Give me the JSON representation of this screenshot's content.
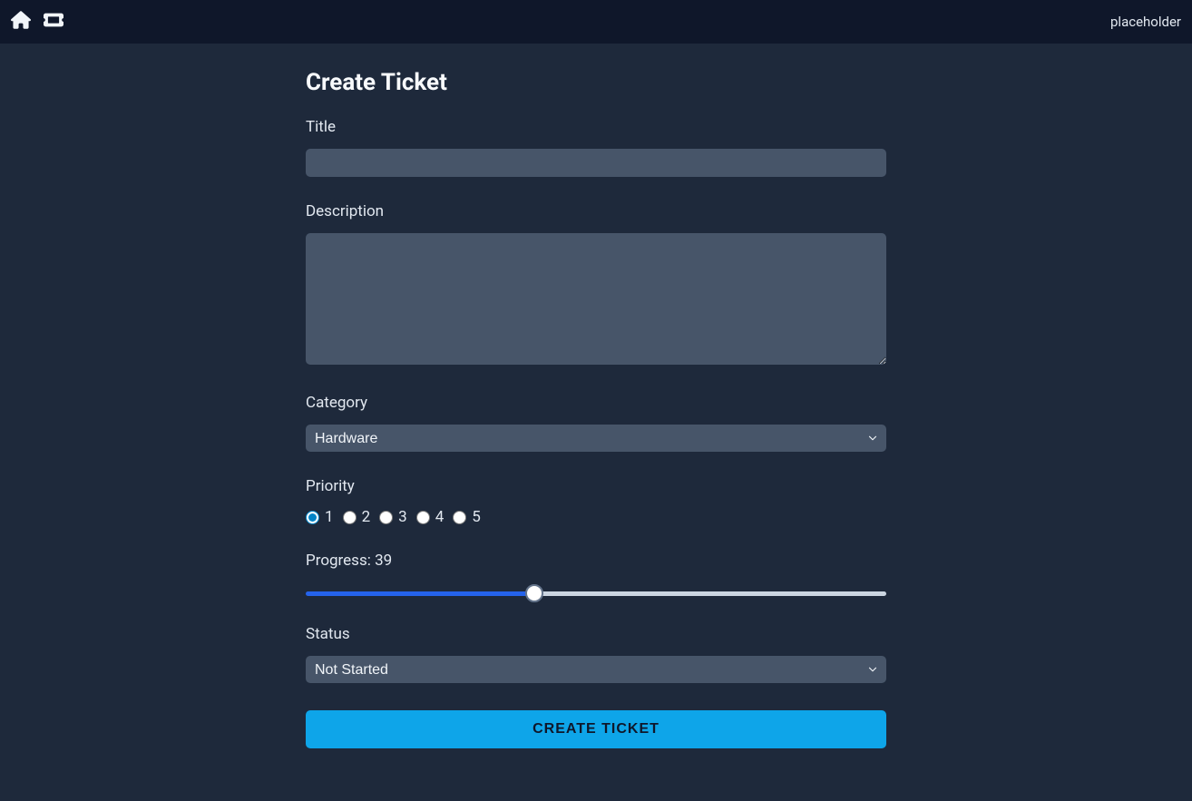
{
  "header": {
    "right_text": "placeholder"
  },
  "form": {
    "heading": "Create Ticket",
    "title": {
      "label": "Title",
      "value": ""
    },
    "description": {
      "label": "Description",
      "value": ""
    },
    "category": {
      "label": "Category",
      "selected": "Hardware"
    },
    "priority": {
      "label": "Priority",
      "options": [
        "1",
        "2",
        "3",
        "4",
        "5"
      ],
      "selected": "1"
    },
    "progress": {
      "label_prefix": "Progress: ",
      "value": 39,
      "min": 0,
      "max": 100
    },
    "status": {
      "label": "Status",
      "selected": "Not Started"
    },
    "submit_label": "CREATE TICKET"
  }
}
